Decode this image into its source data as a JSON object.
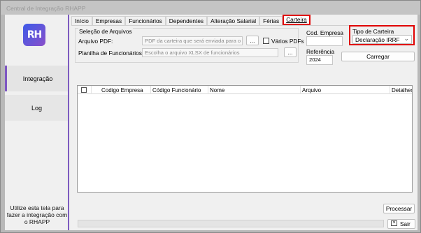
{
  "window": {
    "title": "Central de Integração RHAPP"
  },
  "sidebar": {
    "logo_text": "RH",
    "items": [
      {
        "label": "Integração",
        "active": true
      },
      {
        "label": "Log",
        "active": false
      }
    ],
    "help_text": "Utilize esta tela para fazer a integração com o RHAPP"
  },
  "tabs": [
    {
      "label": "Início"
    },
    {
      "label": "Empresas"
    },
    {
      "label": "Funcionários"
    },
    {
      "label": "Dependentes"
    },
    {
      "label": "Alteração Salarial"
    },
    {
      "label": "Férias"
    },
    {
      "label": "Carteira",
      "active": true
    }
  ],
  "file_selection": {
    "group_title": "Seleção de Arquivos",
    "pdf_label": "Arquivo PDF:",
    "pdf_placeholder": "PDF da carteira que será enviada para o APP",
    "browse_label": "...",
    "multi_pdf_label": "Vários PDFs",
    "sheet_label": "Planilha de Funcionários:",
    "sheet_placeholder": "Escolha o arquivo XLSX de funcionários",
    "browse2_label": "..."
  },
  "company": {
    "label": "Cod. Empresa",
    "value": ""
  },
  "reference": {
    "label": "Referência",
    "value": "2024"
  },
  "wallet_type": {
    "label": "Tipo de Carteira",
    "selected": "Declaração IRRF"
  },
  "load_button": "Carregar",
  "grid": {
    "columns": [
      "Codigo Empresa",
      "Código Funcionário",
      "Nome",
      "Arquivo",
      "Detalhes"
    ],
    "rows": []
  },
  "process_button": "Processar",
  "exit_button": "Sair",
  "colors": {
    "accent": "#7d5bc0",
    "highlight": "#e00000"
  }
}
